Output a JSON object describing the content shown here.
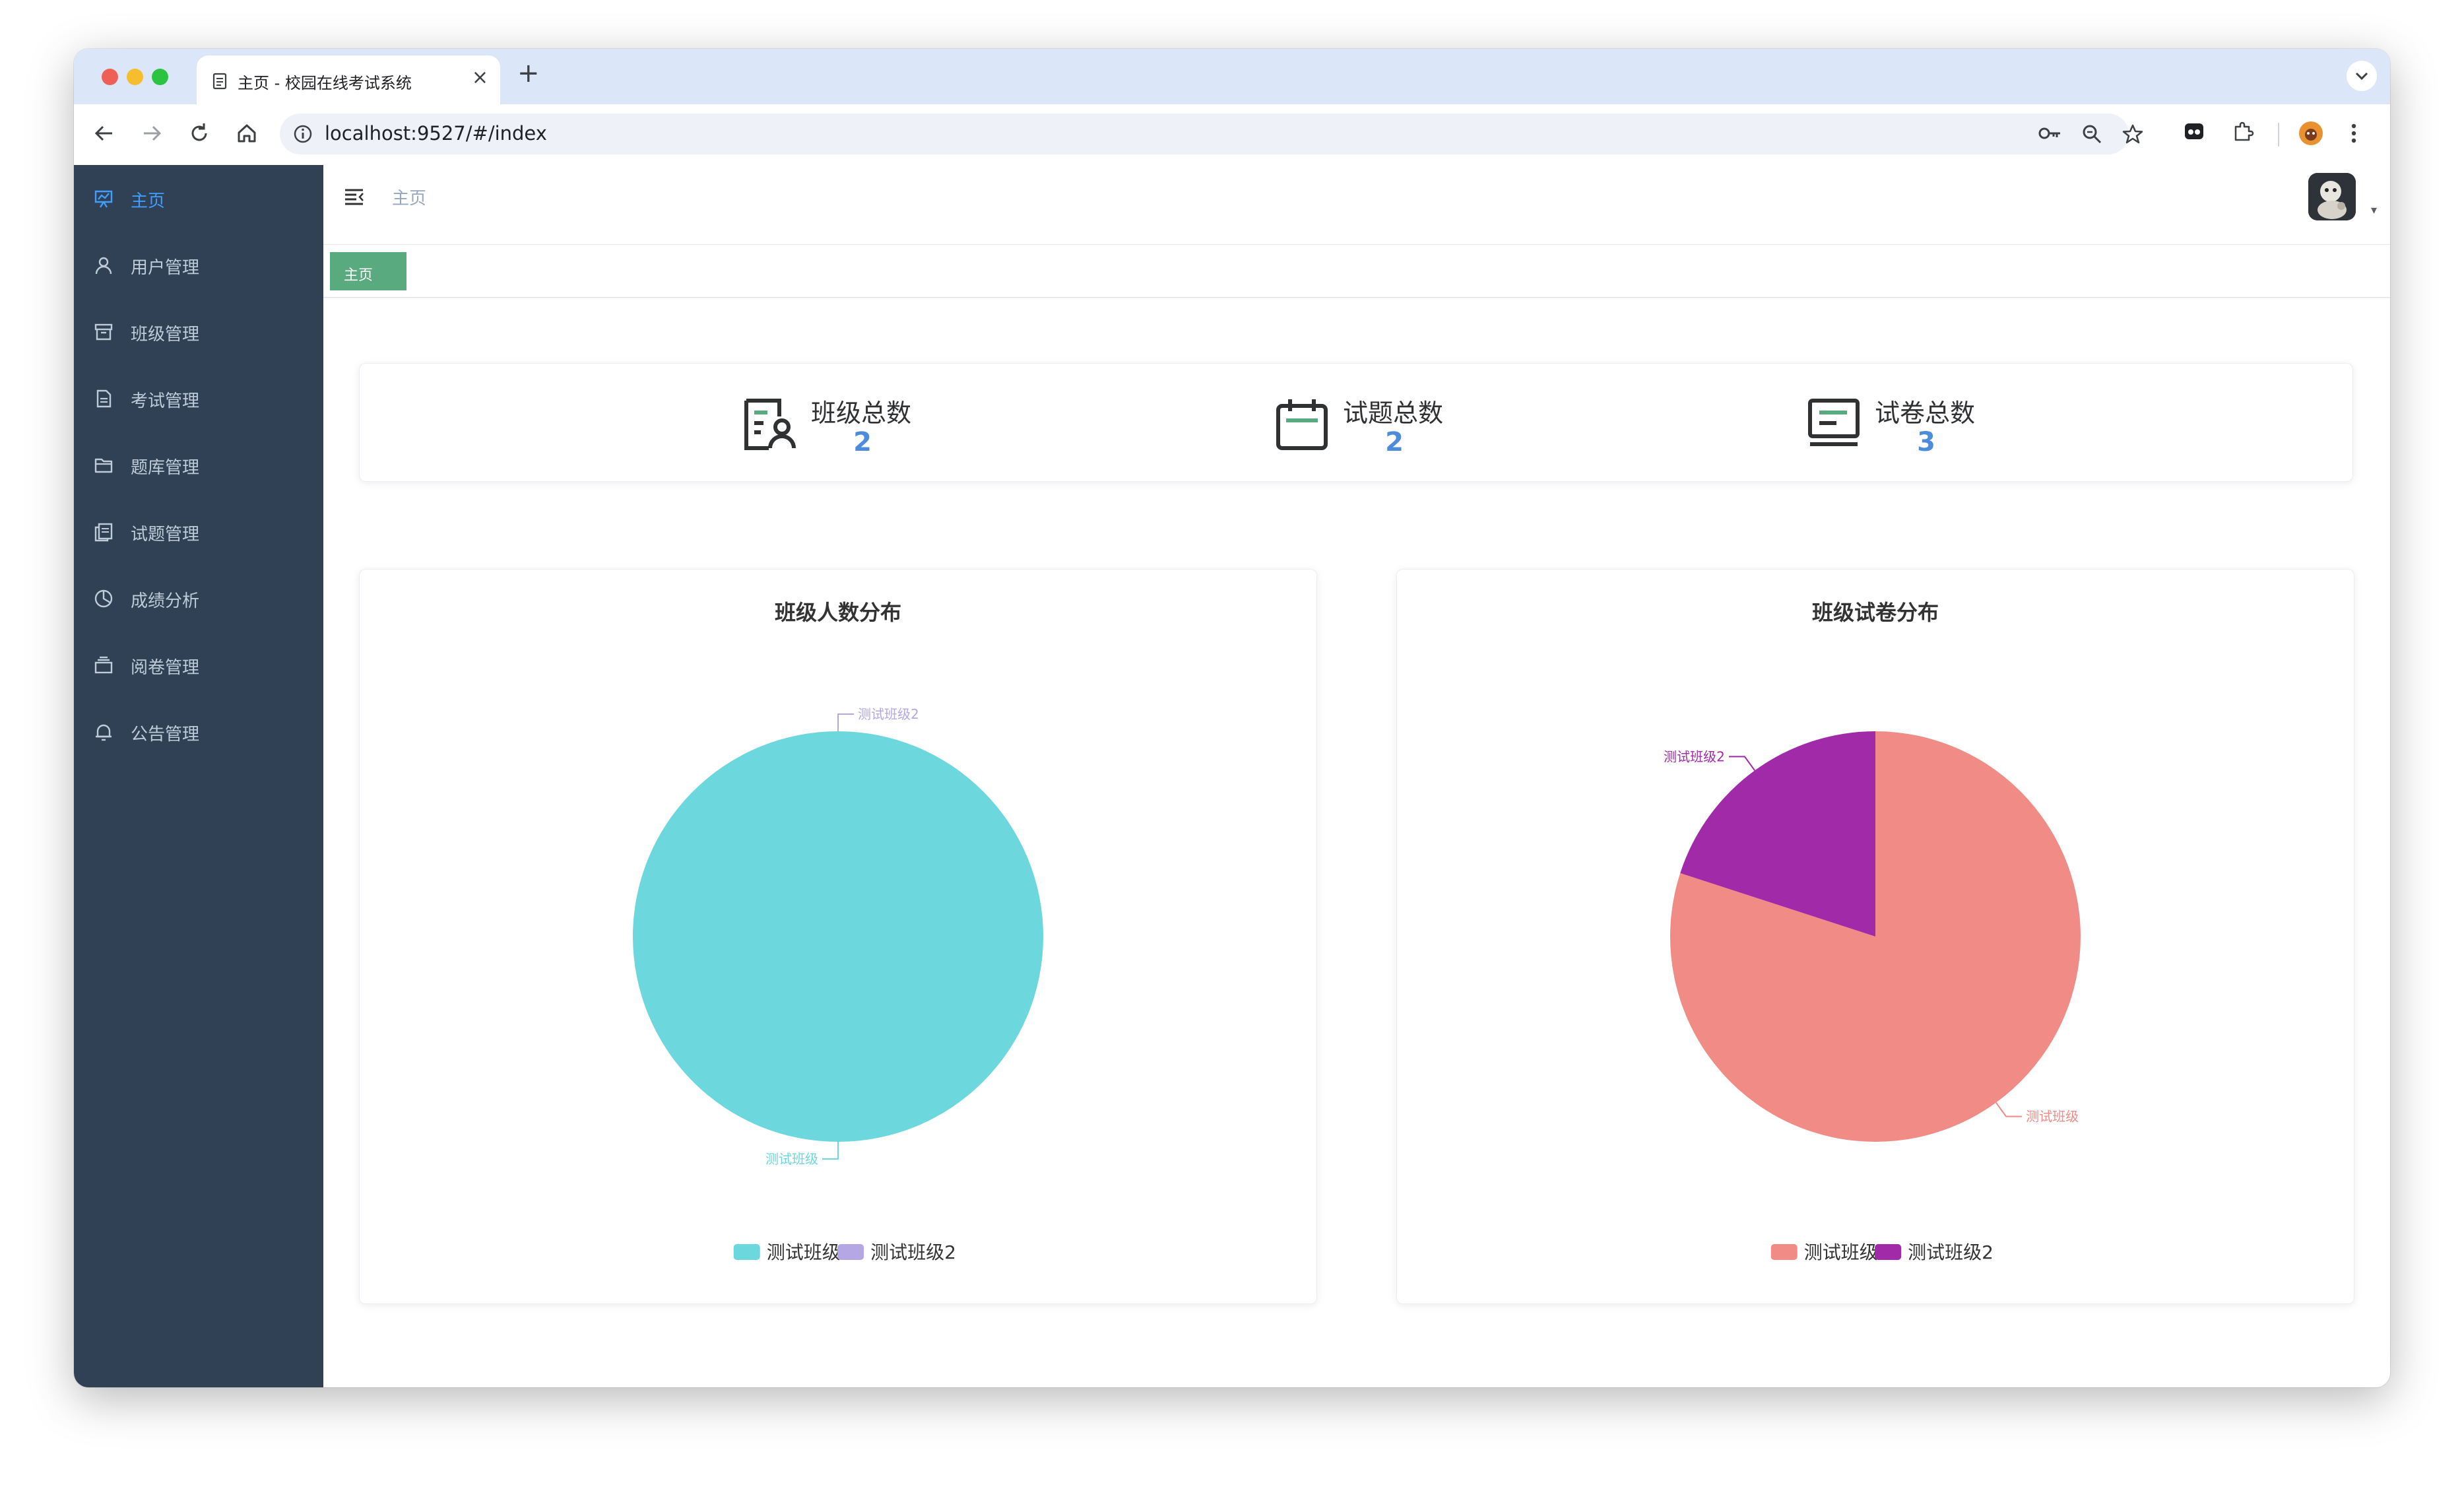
{
  "browser": {
    "tab_title": "主页 - 校园在线考试系统",
    "url": "localhost:9527/#/index",
    "tab_close": "×",
    "new_tab": "+"
  },
  "sidebar": {
    "items": [
      {
        "label": "主页",
        "icon": "dashboard-icon",
        "active": true
      },
      {
        "label": "用户管理",
        "icon": "user-icon"
      },
      {
        "label": "班级管理",
        "icon": "archive-icon"
      },
      {
        "label": "考试管理",
        "icon": "document-icon"
      },
      {
        "label": "题库管理",
        "icon": "folder-icon"
      },
      {
        "label": "试题管理",
        "icon": "copy-document-icon"
      },
      {
        "label": "成绩分析",
        "icon": "pie-chart-icon"
      },
      {
        "label": "阅卷管理",
        "icon": "box-icon"
      },
      {
        "label": "公告管理",
        "icon": "bell-icon"
      }
    ]
  },
  "navbar": {
    "breadcrumb": "主页",
    "caret": "▾"
  },
  "tags": {
    "home": "主页"
  },
  "stats": [
    {
      "label": "班级总数",
      "value": "2",
      "icon": "class-icon"
    },
    {
      "label": "试题总数",
      "value": "2",
      "icon": "calendar-icon"
    },
    {
      "label": "试卷总数",
      "value": "3",
      "icon": "monitor-icon"
    }
  ],
  "colors": {
    "sidebar_bg": "#304156",
    "active_menu": "#409eff",
    "stat_value": "#4c8cdb",
    "tag_bg": "#5aaa7f"
  },
  "chart_data": [
    {
      "type": "pie",
      "title": "班级人数分布",
      "categories": [
        "测试班级",
        "测试班级2"
      ],
      "values": [
        1,
        0
      ],
      "colors": [
        "#6cd7dc",
        "#b4a7e3"
      ],
      "legend": "bottom"
    },
    {
      "type": "pie",
      "title": "班级试卷分布",
      "categories": [
        "测试班级",
        "测试班级2"
      ],
      "values": [
        4,
        1
      ],
      "colors": [
        "#f08b86",
        "#a12aa8"
      ],
      "legend": "bottom"
    }
  ]
}
